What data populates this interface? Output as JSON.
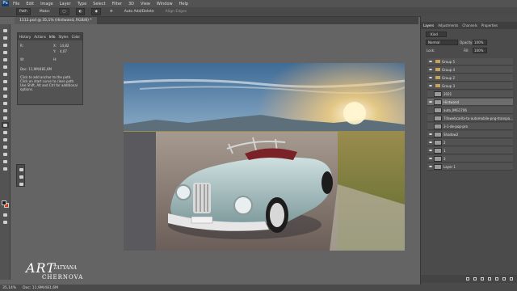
{
  "app": {
    "logo": "Ps"
  },
  "menubar": [
    "File",
    "Edit",
    "Image",
    "Layer",
    "Type",
    "Select",
    "Filter",
    "3D",
    "View",
    "Window",
    "Help"
  ],
  "options_bar": {
    "path": "Path",
    "make_label": "Make:",
    "auto_add_delete": "Auto Add/Delete",
    "align_edges": "Align Edges"
  },
  "document": {
    "tab_title": "1112.psd @ 35,1% (Hintwand, RGB/8) *"
  },
  "history_panel": {
    "tabs": [
      "History",
      "Actions",
      "Info",
      "Styles",
      "Color"
    ],
    "rgb_label": "R:",
    "x_label": "X:",
    "y_label": "Y:",
    "w_label": "W:",
    "h_label": "H:",
    "x_value": "14,82",
    "y_value": "4,07",
    "doc_size": "Doc: 11,9M/481,6M",
    "hint": "Click to add anchor to the path. Click on start curve to close path. Use Shift, Alt and Ctrl for additional options."
  },
  "layers_panel": {
    "tabs": [
      "Layers",
      "Adjustments",
      "Channels",
      "Properties"
    ],
    "active_tab": "Layers",
    "filter_label": "Kind",
    "blend_mode": "Normal",
    "opacity_label": "Opacity:",
    "opacity_value": "100%",
    "lock_label": "Lock:",
    "fill_label": "Fill:",
    "fill_value": "100%",
    "layers": [
      {
        "name": "Group 5",
        "type": "group",
        "visible": true,
        "selected": false
      },
      {
        "name": "Group 4",
        "type": "group",
        "visible": true,
        "selected": false
      },
      {
        "name": "Group 2",
        "type": "group",
        "visible": true,
        "selected": false
      },
      {
        "name": "Group 3",
        "type": "group",
        "visible": true,
        "selected": false
      },
      {
        "name": "2021",
        "type": "layer",
        "visible": false,
        "selected": false
      },
      {
        "name": "Hintwand",
        "type": "layer",
        "visible": true,
        "selected": true
      },
      {
        "name": "auto_IMG1706",
        "type": "layer",
        "visible": false,
        "selected": false
      },
      {
        "name": "7ifawebcaribi-ta-automobile-png-transpa...",
        "type": "layer",
        "visible": false,
        "selected": false
      },
      {
        "name": "3-1-de-pop-pro",
        "type": "layer",
        "visible": false,
        "selected": false
      },
      {
        "name": "Shadow2",
        "type": "layer",
        "visible": true,
        "selected": false
      },
      {
        "name": "2",
        "type": "layer",
        "visible": true,
        "selected": false
      },
      {
        "name": "1",
        "type": "layer",
        "visible": true,
        "selected": false
      },
      {
        "name": "3",
        "type": "layer",
        "visible": true,
        "selected": false
      },
      {
        "name": "Layer 1",
        "type": "layer",
        "visible": true,
        "selected": false
      }
    ]
  },
  "status_bar": {
    "zoom": "35,14%",
    "doc": "Doc: 11,9M/481,6M"
  },
  "watermark": {
    "art": "ART",
    "first": "TATYANA",
    "last": "CHERNOVA"
  },
  "colors": {
    "foreground": "#1b1b1b",
    "background": "#d03d1a"
  }
}
